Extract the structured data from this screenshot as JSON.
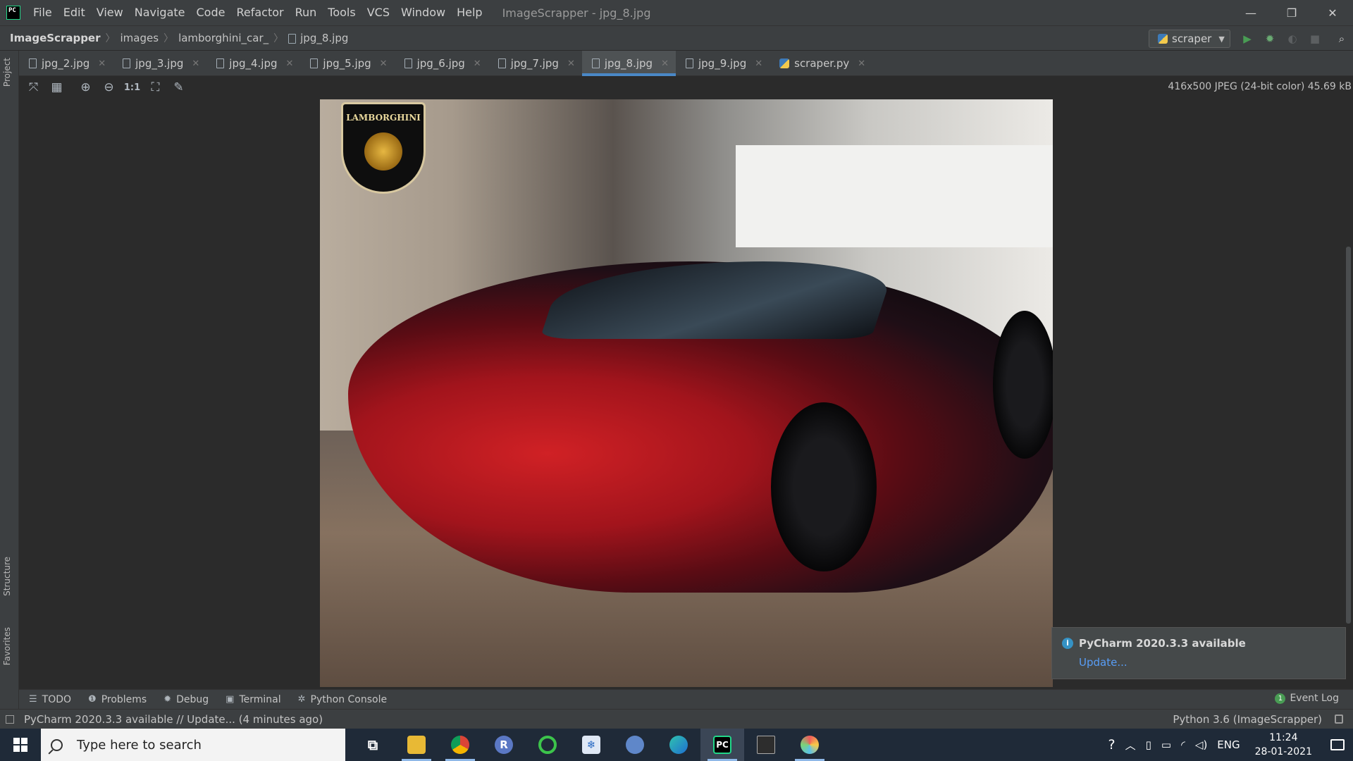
{
  "titlebar": {
    "menu": [
      "File",
      "Edit",
      "View",
      "Navigate",
      "Code",
      "Refactor",
      "Run",
      "Tools",
      "VCS",
      "Window",
      "Help"
    ],
    "window_title": "ImageScrapper - jpg_8.jpg",
    "minimize": "—",
    "restore": "❐",
    "close": "✕"
  },
  "navbar": {
    "crumbs": [
      "ImageScrapper",
      "images",
      "lamborghini_car_",
      "jpg_8.jpg"
    ],
    "run_config": "scraper",
    "run_color": "#499c54",
    "debug_color": "#6aab73"
  },
  "left_strip": {
    "project": "Project",
    "structure": "Structure",
    "favorites": "Favorites"
  },
  "tabs": [
    {
      "label": "jpg_2.jpg",
      "active": false
    },
    {
      "label": "jpg_3.jpg",
      "active": false
    },
    {
      "label": "jpg_4.jpg",
      "active": false
    },
    {
      "label": "jpg_5.jpg",
      "active": false
    },
    {
      "label": "jpg_6.jpg",
      "active": false
    },
    {
      "label": "jpg_7.jpg",
      "active": false
    },
    {
      "label": "jpg_8.jpg",
      "active": true
    },
    {
      "label": "jpg_9.jpg",
      "active": false
    },
    {
      "label": "scraper.py",
      "active": false
    }
  ],
  "image_toolbar": {
    "actual_size": "1:1",
    "info": "416x500 JPEG (24-bit color) 45.69 kB"
  },
  "image": {
    "badge_text": "LAMBORGHINI"
  },
  "notification": {
    "title": "PyCharm 2020.3.3 available",
    "link": "Update..."
  },
  "bottom_tools": [
    "TODO",
    "Problems",
    "Debug",
    "Terminal",
    "Python Console"
  ],
  "event_log": {
    "count": "1",
    "label": "Event Log"
  },
  "statusbar": {
    "message": "PyCharm 2020.3.3 available // Update... (4 minutes ago)",
    "interpreter": "Python 3.6 (ImageScrapper)"
  },
  "taskbar": {
    "search_placeholder": "Type here to search",
    "language": "ENG",
    "time": "11:24",
    "date": "28-01-2021"
  }
}
